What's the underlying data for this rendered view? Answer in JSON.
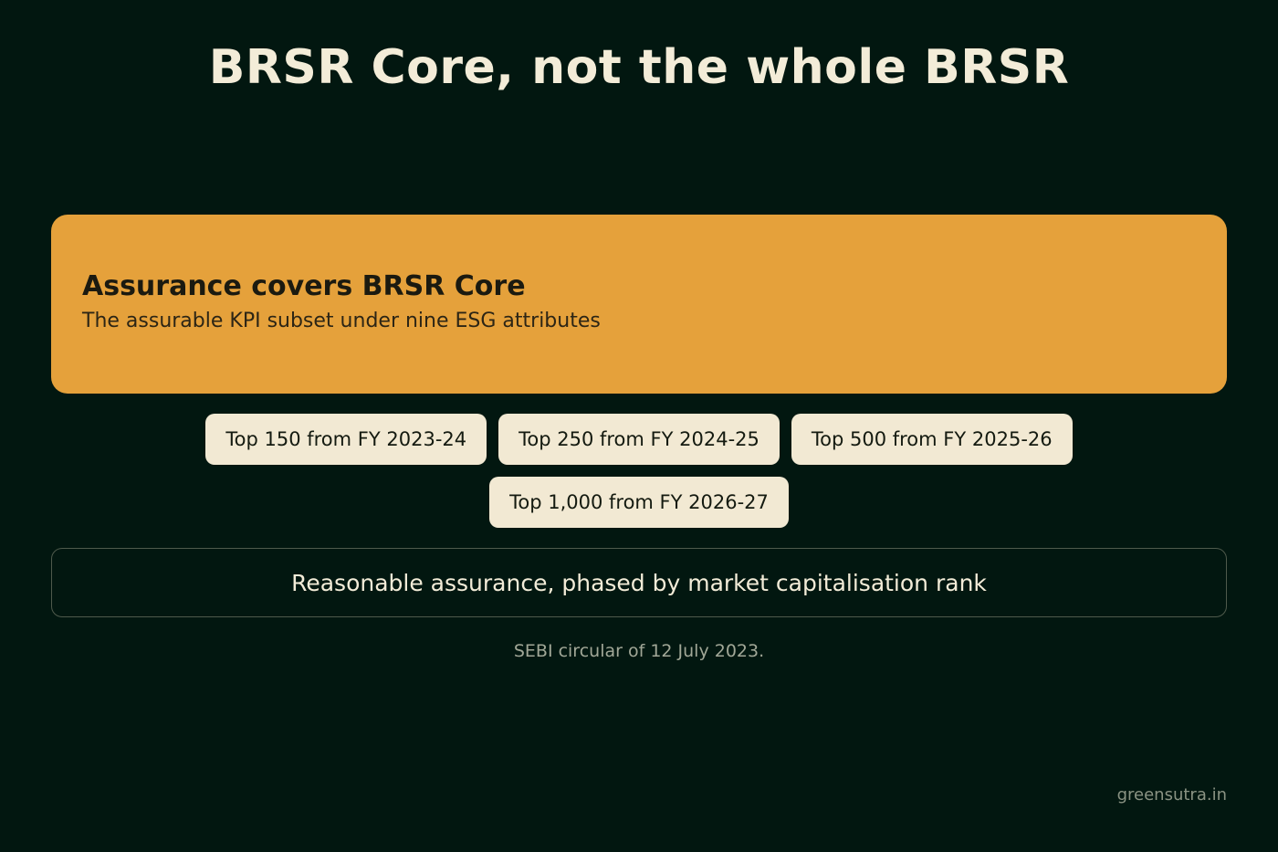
{
  "title": "BRSR Core, not the whole BRSR",
  "card": {
    "heading": "Assurance covers BRSR Core",
    "subheading": "The assurable KPI subset under nine ESG attributes"
  },
  "phases": [
    {
      "label": "Top 150 from FY 2023-24"
    },
    {
      "label": "Top 250 from FY 2024-25"
    },
    {
      "label": "Top 500 from FY 2025-26"
    },
    {
      "label": "Top 1,000 from FY 2026-27"
    }
  ],
  "summary": "Reasonable assurance, phased by market capitalisation rank",
  "source": "SEBI circular of 12 July 2023.",
  "credit": "greensutra.in",
  "colors": {
    "background": "#021710",
    "accent": "#e5a13b",
    "pill": "#f2e9d3",
    "text": "#f3ecd8"
  }
}
